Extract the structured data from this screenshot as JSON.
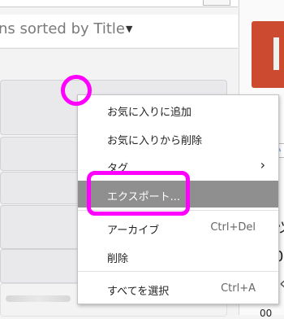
{
  "sortbar": {
    "label": "ns sorted by Title",
    "caret": "▼"
  },
  "right_pane": {
    "glyph_1": "ツ",
    "glyph_2": "00",
    "glyph_3": "く",
    "glyph_4": "00"
  },
  "context_menu": {
    "items": [
      {
        "label": "お気に入りに追加",
        "shortcut": ""
      },
      {
        "label": "お気に入りから削除",
        "shortcut": ""
      },
      {
        "label": "タグ",
        "shortcut": "",
        "submenu_arrow": "›"
      },
      {
        "label": "エクスポート...",
        "shortcut": "",
        "highlighted": true
      },
      {
        "label": "アーカイブ",
        "shortcut": "Ctrl+Del"
      },
      {
        "label": "削除",
        "shortcut": ""
      },
      {
        "label": "すべてを選択",
        "shortcut": "Ctrl+A"
      }
    ]
  },
  "colors": {
    "annotation": "#ff00ff",
    "highlight": "#8f8f8f",
    "accent_tile": "#cc4a2f"
  }
}
